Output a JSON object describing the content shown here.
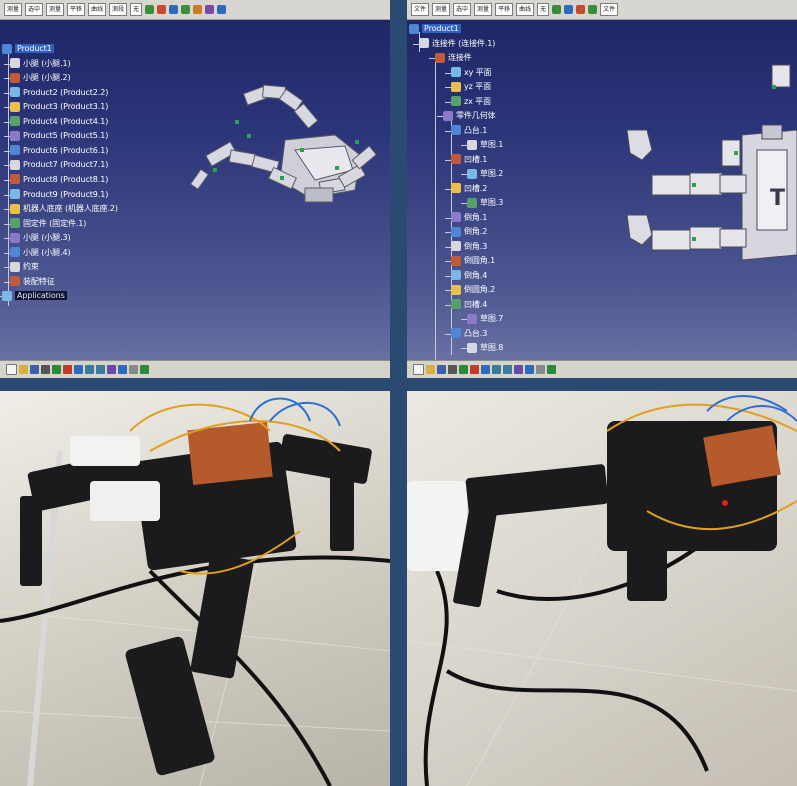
{
  "left_cad": {
    "toolbar": [
      "测量",
      "选中",
      "测量",
      "平移",
      "曲线",
      "测段",
      "无"
    ],
    "tree": [
      {
        "label": "Product1",
        "style": "sel"
      },
      {
        "label": "小腿 (小腿.1)"
      },
      {
        "label": "小腿 (小腿.2)"
      },
      {
        "label": "Product2 (Product2.2)"
      },
      {
        "label": "Product3 (Product3.1)"
      },
      {
        "label": "Product4 (Product4.1)"
      },
      {
        "label": "Product5 (Product5.1)"
      },
      {
        "label": "Product6 (Product6.1)"
      },
      {
        "label": "Product7 (Product7.1)"
      },
      {
        "label": "Product8 (Product8.1)"
      },
      {
        "label": "Product9 (Product9.1)"
      },
      {
        "label": "机器人底座 (机器人底座.2)"
      },
      {
        "label": "固定件 (固定件.1)"
      },
      {
        "label": "小腿 (小腿.3)"
      },
      {
        "label": "小腿 (小腿.4)"
      },
      {
        "label": "约束"
      },
      {
        "label": "装配特征"
      },
      {
        "label": "Applications",
        "style": "inv"
      }
    ]
  },
  "right_cad": {
    "toolbar": [
      "文件",
      "测量",
      "选中",
      "测量",
      "平移",
      "曲线",
      "无",
      "文件"
    ],
    "tree": [
      {
        "label": "Product1",
        "style": "sel"
      },
      {
        "label": "连接件 (连接件.1)"
      },
      {
        "label": "连接件"
      },
      {
        "label": "xy 平面"
      },
      {
        "label": "yz 平面"
      },
      {
        "label": "zx 平面"
      },
      {
        "label": "零件几何体"
      },
      {
        "label": "凸台.1"
      },
      {
        "label": "草图.1"
      },
      {
        "label": "凹槽.1"
      },
      {
        "label": "草图.2"
      },
      {
        "label": "凹槽.2"
      },
      {
        "label": "草图.3"
      },
      {
        "label": "倒角.1"
      },
      {
        "label": "倒角.2"
      },
      {
        "label": "倒角.3"
      },
      {
        "label": "倒圆角.1"
      },
      {
        "label": "倒角.4"
      },
      {
        "label": "倒圆角.2"
      },
      {
        "label": "凹槽.4"
      },
      {
        "label": "草图.7"
      },
      {
        "label": "凸台.3"
      },
      {
        "label": "草图.8"
      }
    ]
  },
  "colors": {
    "background": "#2b4a72",
    "viewport_top": "#1c2463",
    "viewport_bottom": "#6f76a8",
    "selection": "#2f61c4"
  }
}
